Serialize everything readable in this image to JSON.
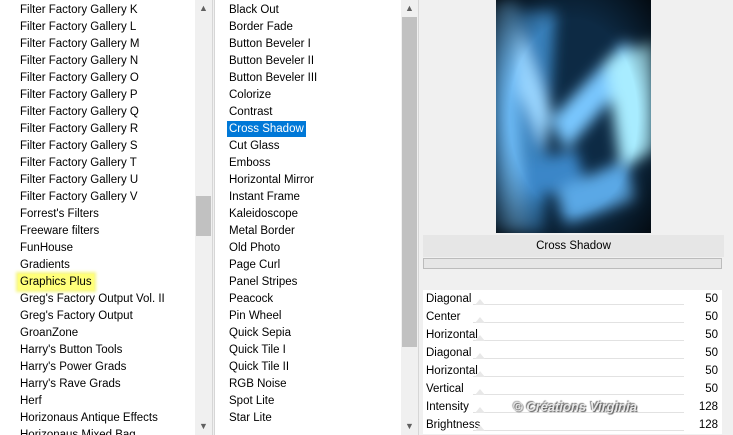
{
  "categories": {
    "items": [
      {
        "label": "Filter Factory Gallery K"
      },
      {
        "label": "Filter Factory Gallery L"
      },
      {
        "label": "Filter Factory Gallery M"
      },
      {
        "label": "Filter Factory Gallery N"
      },
      {
        "label": "Filter Factory Gallery O"
      },
      {
        "label": "Filter Factory Gallery P"
      },
      {
        "label": "Filter Factory Gallery Q"
      },
      {
        "label": "Filter Factory Gallery R"
      },
      {
        "label": "Filter Factory Gallery S"
      },
      {
        "label": "Filter Factory Gallery T"
      },
      {
        "label": "Filter Factory Gallery U"
      },
      {
        "label": "Filter Factory Gallery V"
      },
      {
        "label": "Forrest's Filters"
      },
      {
        "label": "Freeware filters"
      },
      {
        "label": "FunHouse"
      },
      {
        "label": "Gradients"
      },
      {
        "label": "Graphics Plus",
        "highlighted": true
      },
      {
        "label": "Greg's Factory Output Vol. II"
      },
      {
        "label": "Greg's Factory Output"
      },
      {
        "label": "GroanZone"
      },
      {
        "label": "Harry's Button Tools"
      },
      {
        "label": "Harry's Power Grads"
      },
      {
        "label": "Harry's Rave Grads"
      },
      {
        "label": "Herf"
      },
      {
        "label": "Horizonaus Antique Effects"
      },
      {
        "label": "Horizonaus Mixed Bag"
      }
    ],
    "scroll_position": 0.47
  },
  "filters": {
    "items": [
      {
        "label": "Black Out"
      },
      {
        "label": "Border Fade"
      },
      {
        "label": "Button Beveler I"
      },
      {
        "label": "Button Beveler II"
      },
      {
        "label": "Button Beveler III"
      },
      {
        "label": "Colorize"
      },
      {
        "label": "Contrast"
      },
      {
        "label": "Cross Shadow",
        "selected": true
      },
      {
        "label": "Cut Glass"
      },
      {
        "label": "Emboss"
      },
      {
        "label": "Horizontal Mirror"
      },
      {
        "label": "Instant Frame"
      },
      {
        "label": "Kaleidoscope"
      },
      {
        "label": "Metal Border"
      },
      {
        "label": "Old Photo"
      },
      {
        "label": "Page Curl"
      },
      {
        "label": "Panel Stripes"
      },
      {
        "label": "Peacock"
      },
      {
        "label": "Pin Wheel"
      },
      {
        "label": "Quick Sepia"
      },
      {
        "label": "Quick Tile I"
      },
      {
        "label": "Quick Tile II"
      },
      {
        "label": "RGB Noise"
      },
      {
        "label": "Spot Lite"
      },
      {
        "label": "Star Lite"
      }
    ],
    "scroll_position": 0.0
  },
  "preview": {
    "filter_name": "Cross Shadow"
  },
  "parameters": [
    {
      "label": "Diagonal",
      "value": "50"
    },
    {
      "label": "Center",
      "value": "50"
    },
    {
      "label": "Horizontal",
      "value": "50"
    },
    {
      "label": "Diagonal",
      "value": "50"
    },
    {
      "label": "Horizontal",
      "value": "50"
    },
    {
      "label": "Vertical",
      "value": "50"
    },
    {
      "label": "Intensity",
      "value": "128"
    },
    {
      "label": "Brightness",
      "value": "128"
    }
  ],
  "watermark": {
    "text": "© Créations Virginia"
  },
  "colors": {
    "selection": "#0078d7",
    "highlight": "#ffff7a"
  }
}
